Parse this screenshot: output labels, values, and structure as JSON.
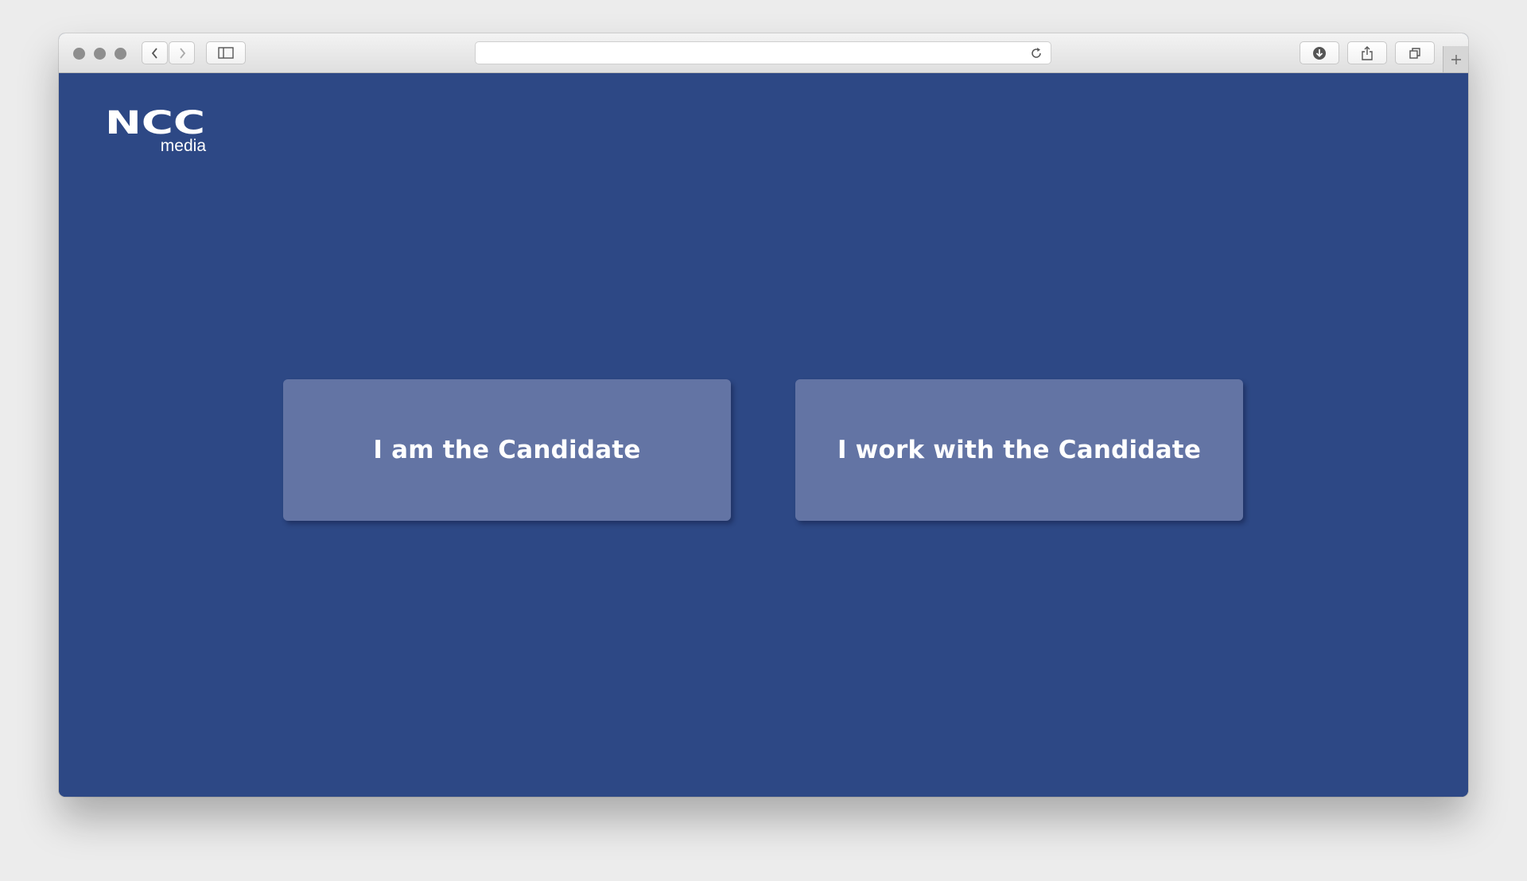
{
  "browser": {
    "address_bar": {
      "url": "",
      "placeholder": ""
    },
    "icons": {
      "back": "chevron-left-icon",
      "forward": "chevron-right-icon",
      "sidebar": "sidebar-icon",
      "reload": "reload-icon",
      "downloads": "download-icon",
      "share": "share-icon",
      "tabs": "tabs-icon",
      "new_tab": "plus-icon"
    }
  },
  "page": {
    "background_color": "#2d4885",
    "logo": {
      "brand": "NCC",
      "sub": "media"
    },
    "choices": [
      {
        "label": "I am the Candidate"
      },
      {
        "label": "I work with the Candidate"
      }
    ],
    "button_color": "#6374a4"
  }
}
